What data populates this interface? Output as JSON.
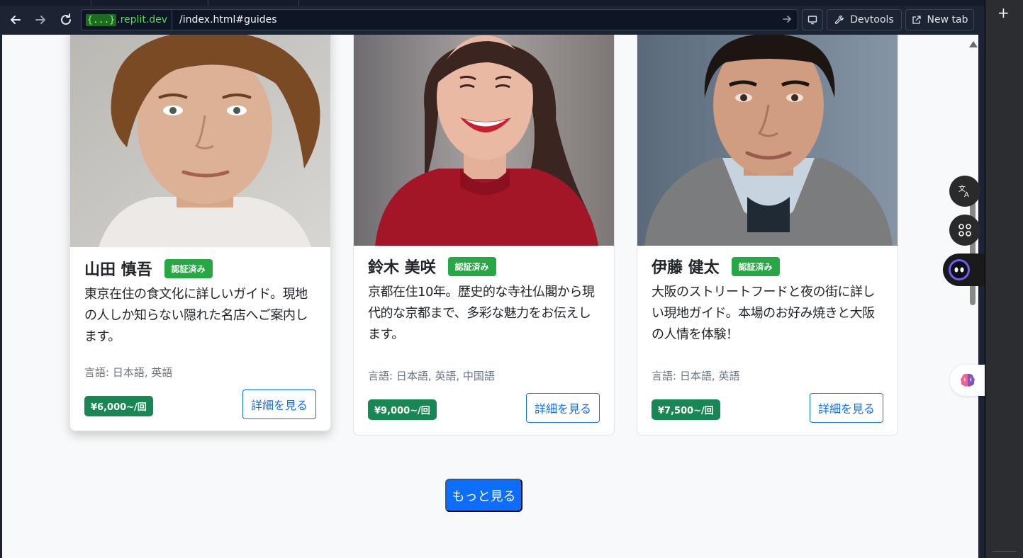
{
  "browser": {
    "url_host_brace": "{...}",
    "url_host_domain": ".replit.dev",
    "url_path": "/index.html#guides",
    "devtools_label": "Devtools",
    "newtab_label": "New tab",
    "icons": [
      "back-arrow-icon",
      "forward-arrow-icon",
      "reload-icon",
      "go-arrow-icon",
      "monitor-icon",
      "wrench-icon",
      "external-link-icon",
      "plus-icon"
    ]
  },
  "guides": [
    {
      "name": "山田 慎吾",
      "badge": "認証済み",
      "description": "東京在住の食文化に詳しいガイド。現地の人しか知らない隠れた名店へご案内します。",
      "languages": "言語: 日本語, 英語",
      "price": "¥6,000~/回",
      "detail_label": "詳細を見る"
    },
    {
      "name": "鈴木 美咲",
      "badge": "認証済み",
      "description": "京都在住10年。歴史的な寺社仏閣から現代的な京都まで、多彩な魅力をお伝えします。",
      "languages": "言語: 日本語, 英語, 中国語",
      "price": "¥9,000~/回",
      "detail_label": "詳細を見る"
    },
    {
      "name": "伊藤 健太",
      "badge": "認証済み",
      "description": "大阪のストリートフードと夜の街に詳しい現地ガイド。本場のお好み焼きと大阪の人情を体験！",
      "languages": "言語: 日本語, 英語",
      "price": "¥7,500~/回",
      "detail_label": "詳細を見る"
    }
  ],
  "more_label": "もっと見る",
  "colors": {
    "primary": "#0d6efd",
    "verified": "#28a745",
    "price": "#198754",
    "chrome": "#1c2333"
  }
}
